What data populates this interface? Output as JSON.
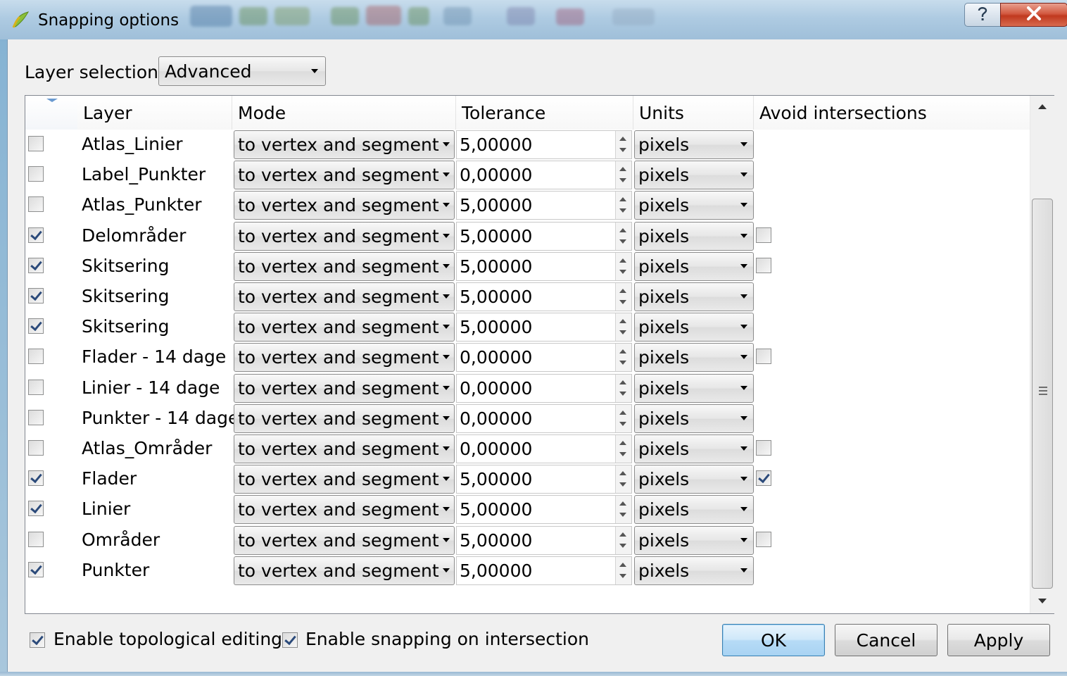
{
  "window": {
    "title": "Snapping options",
    "help_icon": "question-mark-icon",
    "close_icon": "close-x-icon"
  },
  "layer_selection": {
    "label": "Layer selection",
    "value": "Advanced"
  },
  "table": {
    "headers": [
      "Layer",
      "Mode",
      "Tolerance",
      "Units",
      "Avoid intersections"
    ],
    "rows": [
      {
        "enabled": false,
        "layer": "Atlas_Linier",
        "mode": "to vertex and segment",
        "tolerance": "5,00000",
        "units": "pixels",
        "avoid": null
      },
      {
        "enabled": false,
        "layer": "Label_Punkter",
        "mode": "to vertex and segment",
        "tolerance": "0,00000",
        "units": "pixels",
        "avoid": null
      },
      {
        "enabled": false,
        "layer": "Atlas_Punkter",
        "mode": "to vertex and segment",
        "tolerance": "5,00000",
        "units": "pixels",
        "avoid": null
      },
      {
        "enabled": true,
        "layer": "Delområder",
        "mode": "to vertex and segment",
        "tolerance": "5,00000",
        "units": "pixels",
        "avoid": false
      },
      {
        "enabled": true,
        "layer": "Skitsering",
        "mode": "to vertex and segment",
        "tolerance": "5,00000",
        "units": "pixels",
        "avoid": false
      },
      {
        "enabled": true,
        "layer": "Skitsering",
        "mode": "to vertex and segment",
        "tolerance": "5,00000",
        "units": "pixels",
        "avoid": null
      },
      {
        "enabled": true,
        "layer": "Skitsering",
        "mode": "to vertex and segment",
        "tolerance": "5,00000",
        "units": "pixels",
        "avoid": null
      },
      {
        "enabled": false,
        "layer": "Flader - 14 dage",
        "mode": "to vertex and segment",
        "tolerance": "0,00000",
        "units": "pixels",
        "avoid": false
      },
      {
        "enabled": false,
        "layer": "Linier - 14 dage",
        "mode": "to vertex and segment",
        "tolerance": "0,00000",
        "units": "pixels",
        "avoid": null
      },
      {
        "enabled": false,
        "layer": "Punkter - 14 dage",
        "mode": "to vertex and segment",
        "tolerance": "0,00000",
        "units": "pixels",
        "avoid": null
      },
      {
        "enabled": false,
        "layer": "Atlas_Områder",
        "mode": "to vertex and segment",
        "tolerance": "0,00000",
        "units": "pixels",
        "avoid": false
      },
      {
        "enabled": true,
        "layer": "Flader",
        "mode": "to vertex and segment",
        "tolerance": "5,00000",
        "units": "pixels",
        "avoid": true
      },
      {
        "enabled": true,
        "layer": "Linier",
        "mode": "to vertex and segment",
        "tolerance": "5,00000",
        "units": "pixels",
        "avoid": null
      },
      {
        "enabled": false,
        "layer": "Områder",
        "mode": "to vertex and segment",
        "tolerance": "5,00000",
        "units": "pixels",
        "avoid": false
      },
      {
        "enabled": true,
        "layer": "Punkter",
        "mode": "to vertex and segment",
        "tolerance": "5,00000",
        "units": "pixels",
        "avoid": null
      }
    ]
  },
  "options": {
    "topological_editing": {
      "label": "Enable topological editing",
      "checked": true
    },
    "snapping_on_intersection": {
      "label": "Enable snapping on intersection",
      "checked": true
    }
  },
  "buttons": {
    "ok": "OK",
    "cancel": "Cancel",
    "apply": "Apply"
  },
  "colors": {
    "default_button": "#b6dbf6",
    "close_button": "#c0391f",
    "checkmark": "#2b4a7a"
  }
}
